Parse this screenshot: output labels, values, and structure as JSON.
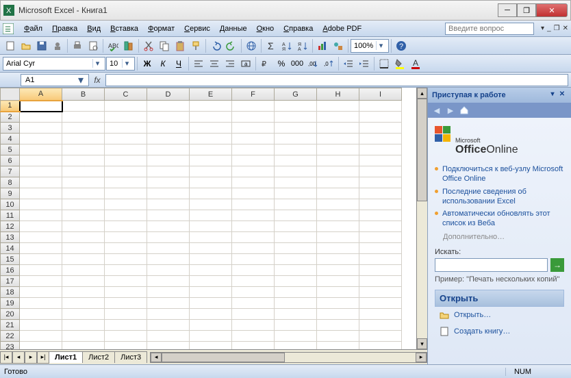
{
  "title": "Microsoft Excel - Книга1",
  "menu": [
    "Файл",
    "Правка",
    "Вид",
    "Вставка",
    "Формат",
    "Сервис",
    "Данные",
    "Окно",
    "Справка",
    "Adobe PDF"
  ],
  "askbox_placeholder": "Введите вопрос",
  "toolbar1": {
    "zoom": "100%"
  },
  "fmtbar": {
    "font": "Arial Cyr",
    "size": "10"
  },
  "namebox": "A1",
  "formula": "",
  "columns": [
    "A",
    "B",
    "C",
    "D",
    "E",
    "F",
    "G",
    "H",
    "I"
  ],
  "rows": [
    1,
    2,
    3,
    4,
    5,
    6,
    7,
    8,
    9,
    10,
    11,
    12,
    13,
    14,
    15,
    16,
    17,
    18,
    19,
    20,
    21,
    22,
    23
  ],
  "active_cell": {
    "row": 1,
    "col": "A"
  },
  "sheets": [
    "Лист1",
    "Лист2",
    "Лист3"
  ],
  "active_sheet": 0,
  "taskpane": {
    "title": "Приступая к работе",
    "logo_small": "Microsoft",
    "logo_bold": "Office",
    "logo_rest": "Online",
    "links": [
      "Подключиться к веб-узлу Microsoft Office Online",
      "Последние сведения об использовании Excel",
      "Автоматически обновлять этот список из Веба"
    ],
    "more": "Дополнительно…",
    "search_label": "Искать:",
    "example_label": "Пример:",
    "example_text": "\"Печать нескольких копий\"",
    "open_header": "Открыть",
    "open_items": [
      "Открыть…",
      "Создать книгу…"
    ]
  },
  "status": {
    "ready": "Готово",
    "num": "NUM"
  }
}
